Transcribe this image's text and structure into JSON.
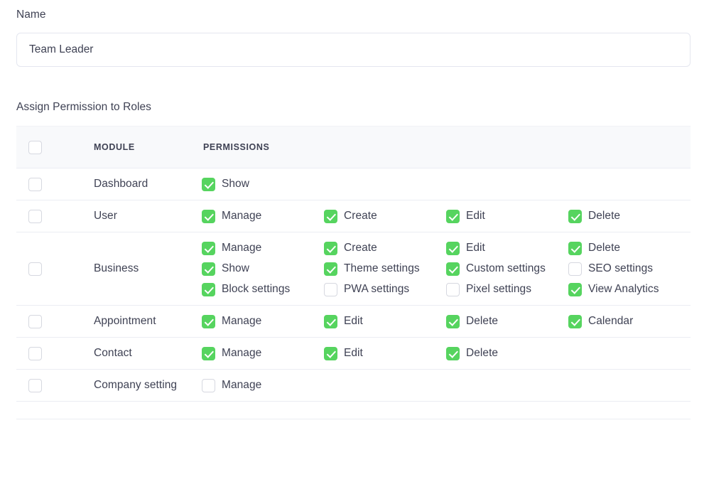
{
  "form": {
    "name_label": "Name",
    "name_value": "Team Leader",
    "name_placeholder": "Name"
  },
  "section": {
    "title": "Assign Permission to Roles"
  },
  "table": {
    "headers": {
      "select_all": "",
      "module": "MODULE",
      "permissions": "PERMISSIONS"
    },
    "rows": [
      {
        "row_selected": false,
        "module": "Dashboard",
        "permissions": [
          {
            "label": "Show",
            "checked": true
          }
        ]
      },
      {
        "row_selected": false,
        "module": "User",
        "permissions": [
          {
            "label": "Manage",
            "checked": true
          },
          {
            "label": "Create",
            "checked": true
          },
          {
            "label": "Edit",
            "checked": true
          },
          {
            "label": "Delete",
            "checked": true
          }
        ]
      },
      {
        "row_selected": false,
        "module": "Business",
        "permissions": [
          {
            "label": "Manage",
            "checked": true
          },
          {
            "label": "Create",
            "checked": true
          },
          {
            "label": "Edit",
            "checked": true
          },
          {
            "label": "Delete",
            "checked": true
          },
          {
            "label": "Show",
            "checked": true
          },
          {
            "label": "Theme settings",
            "checked": true
          },
          {
            "label": "Custom settings",
            "checked": true
          },
          {
            "label": "SEO settings",
            "checked": false
          },
          {
            "label": "Block settings",
            "checked": true
          },
          {
            "label": "PWA settings",
            "checked": false
          },
          {
            "label": "Pixel settings",
            "checked": false
          },
          {
            "label": "View Analytics",
            "checked": true
          }
        ]
      },
      {
        "row_selected": false,
        "module": "Appointment",
        "permissions": [
          {
            "label": "Manage",
            "checked": true
          },
          {
            "label": "Edit",
            "checked": true
          },
          {
            "label": "Delete",
            "checked": true
          },
          {
            "label": "Calendar",
            "checked": true
          }
        ]
      },
      {
        "row_selected": false,
        "module": "Contact",
        "permissions": [
          {
            "label": "Manage",
            "checked": true
          },
          {
            "label": "Edit",
            "checked": true
          },
          {
            "label": "Delete",
            "checked": true
          }
        ]
      },
      {
        "row_selected": false,
        "module": "Company setting",
        "permissions": [
          {
            "label": "Manage",
            "checked": false
          }
        ]
      }
    ]
  },
  "colors": {
    "checkbox_on": "#56d45f",
    "checkbox_off_border": "#d6d8e0",
    "text": "#3f4254",
    "header_bg": "#f8f9fb",
    "border": "#ebedf3"
  }
}
